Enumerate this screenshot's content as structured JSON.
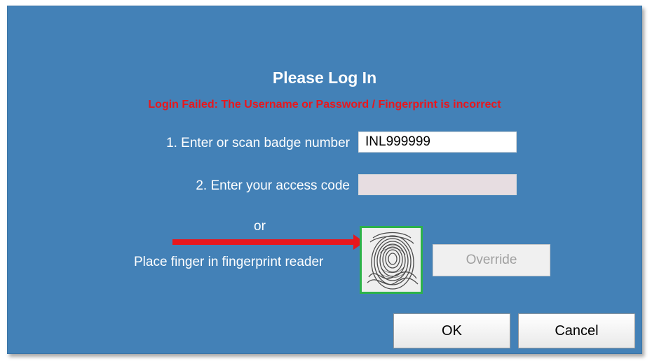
{
  "dialog": {
    "title": "Please Log In",
    "error_message": "Login Failed: The Username or Password / Fingerprint is incorrect",
    "error_color": "#e8171d",
    "background_color": "#4381b7"
  },
  "badge": {
    "label": "1.  Enter or scan badge number",
    "value": "INL999999"
  },
  "access_code": {
    "label": "2.  Enter your access code",
    "value": ""
  },
  "fingerprint": {
    "or_label": "or",
    "label": "Place finger in fingerprint reader",
    "icon": "fingerprint-icon",
    "border_color": "#2db24a",
    "arrow_color": "#e8171d"
  },
  "buttons": {
    "override_label": "Override",
    "ok_label": "OK",
    "cancel_label": "Cancel"
  }
}
